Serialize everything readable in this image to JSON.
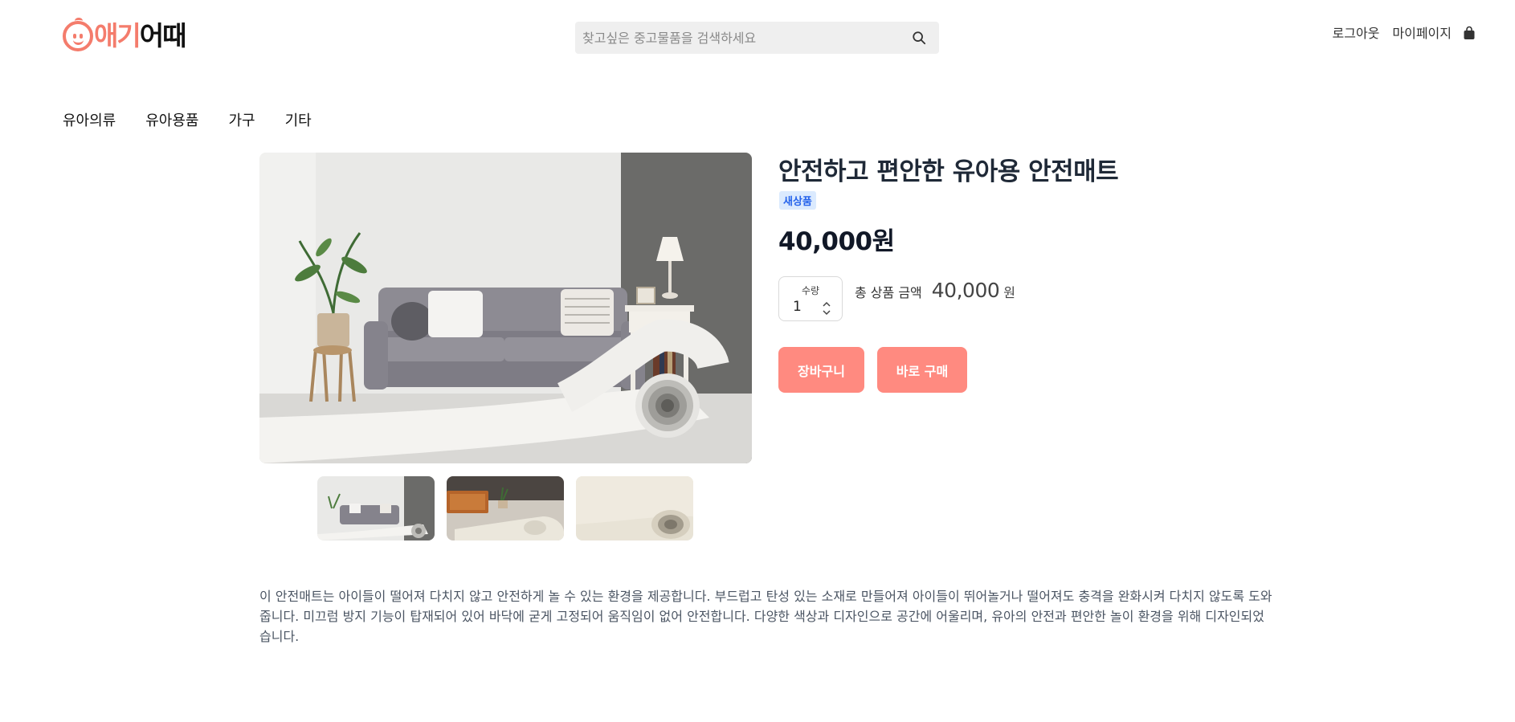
{
  "header": {
    "logo": {
      "part1": "애기",
      "part2": "어때"
    },
    "search_placeholder": "찾고싶은 중고물품을 검색하세요",
    "links": {
      "logout": "로그아웃",
      "mypage": "마이페이지"
    }
  },
  "categories": [
    "유아의류",
    "유아용품",
    "가구",
    "기타"
  ],
  "product": {
    "title": "안전하고 편안한 유아용 안전매트",
    "badge": "새상품",
    "price": "40,000원",
    "quantity_label": "수량",
    "quantity_value": "1",
    "total_label": "총 상품 금액",
    "total_amount": "40,000",
    "total_unit": "원",
    "cart_button": "장바구니",
    "buy_button": "바로 구매",
    "description": "이 안전매트는 아이들이 떨어져 다치지 않고 안전하게 놀 수 있는 환경을 제공합니다. 부드럽고 탄성 있는 소재로 만들어져 아이들이 뛰어놀거나 떨어져도 충격을 완화시켜 다치지 않도록 도와줍니다. 미끄럼 방지 기능이 탑재되어 있어 바닥에 굳게 고정되어 움직임이 없어 안전합니다. 다양한 색상과 디자인으로 공간에 어울리며, 유아의 안전과 편안한 놀이 환경을 위해 디자인되었습니다."
  },
  "colors": {
    "accent": "#ff8a80",
    "logo": "#f47c6c",
    "badge_bg": "#dbeafe",
    "badge_text": "#2563eb"
  },
  "icons": [
    "search-icon",
    "shopping-bag-icon",
    "spinner-arrows-icon"
  ]
}
